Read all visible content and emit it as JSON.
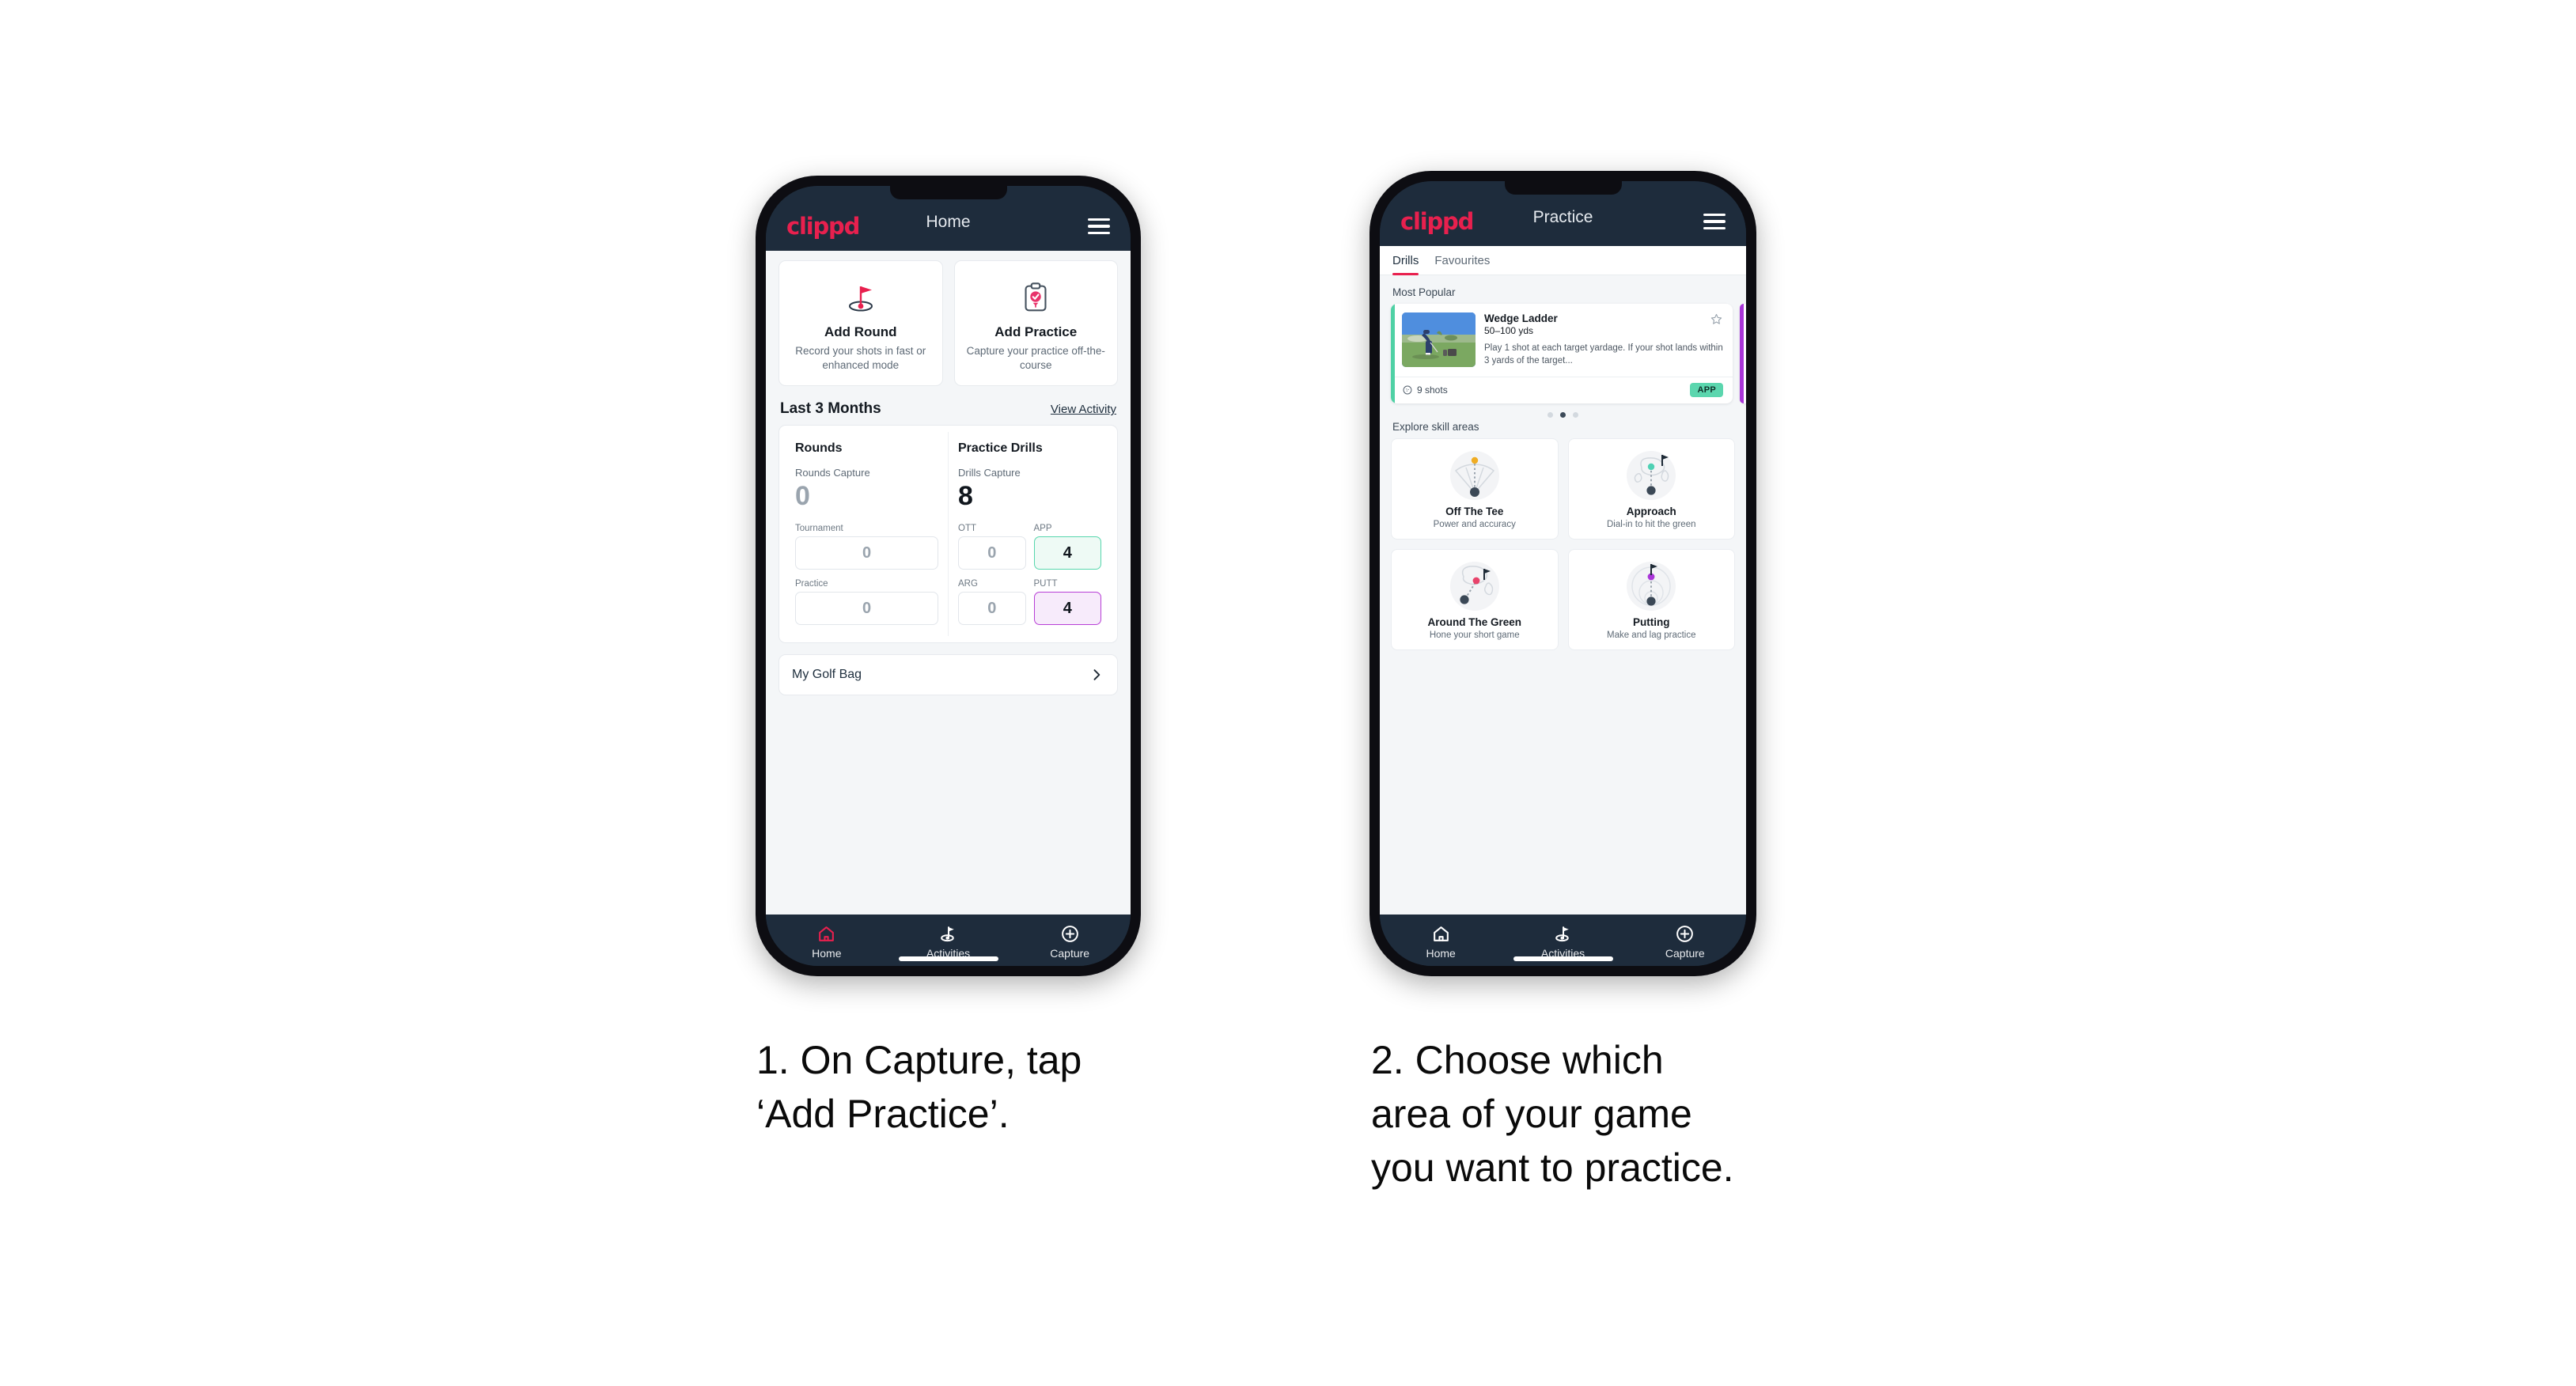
{
  "brand": {
    "logo": "clippd",
    "accent": "#e8204e",
    "dark_bg": "#1e2c3c"
  },
  "phone1": {
    "header": {
      "logo": "clippd",
      "title": "Home",
      "menu_icon": "hamburger-menu-icon"
    },
    "actions": [
      {
        "icon": "golf-flag-icon",
        "title": "Add Round",
        "subtitle": "Record your shots in fast or enhanced mode"
      },
      {
        "icon": "clipboard-check-icon",
        "title": "Add Practice",
        "subtitle": "Capture your practice off-the-course"
      }
    ],
    "section": {
      "title": "Last 3 Months",
      "link": "View Activity"
    },
    "rounds": {
      "heading": "Rounds",
      "capture_label": "Rounds Capture",
      "capture_value": "0",
      "metrics": [
        {
          "label": "Tournament",
          "value": "0",
          "highlight": "none"
        },
        {
          "label": "Practice",
          "value": "0",
          "highlight": "none"
        }
      ]
    },
    "drills": {
      "heading": "Practice Drills",
      "capture_label": "Drills Capture",
      "capture_value": "8",
      "metrics": [
        {
          "label": "OTT",
          "value": "0",
          "highlight": "none"
        },
        {
          "label": "APP",
          "value": "4",
          "highlight": "mint"
        },
        {
          "label": "ARG",
          "value": "0",
          "highlight": "none"
        },
        {
          "label": "PUTT",
          "value": "4",
          "highlight": "violet"
        }
      ]
    },
    "golf_bag": {
      "label": "My Golf Bag",
      "chevron_icon": "chevron-right-icon"
    },
    "nav": [
      {
        "label": "Home",
        "icon": "home-icon",
        "active": true
      },
      {
        "label": "Activities",
        "icon": "golf-flag-nav-icon",
        "active": false
      },
      {
        "label": "Capture",
        "icon": "plus-circle-icon",
        "active": false
      }
    ]
  },
  "phone2": {
    "header": {
      "logo": "clippd",
      "title": "Practice",
      "menu_icon": "hamburger-menu-icon"
    },
    "tabs": [
      {
        "label": "Drills",
        "active": true
      },
      {
        "label": "Favourites",
        "active": false
      }
    ],
    "most_popular_label": "Most Popular",
    "drill_card": {
      "title": "Wedge Ladder",
      "yardage": "50–100 yds",
      "description": "Play 1 shot at each target yardage. If your shot lands within 3 yards of the target...",
      "shots": "9 shots",
      "shots_icon": "golf-ball-icon",
      "badge": "APP",
      "badge_color": "#5bd6ae",
      "accent_color": "#4fd1a5",
      "star_icon": "star-outline-icon",
      "thumbnail": "golfer-chipping-photo"
    },
    "next_card_accent": "#a935d8",
    "carousel_dots": {
      "count": 3,
      "active_index": 1
    },
    "explore_label": "Explore skill areas",
    "skill_areas": [
      {
        "name": "Off The Tee",
        "subtitle": "Power and accuracy",
        "icon": "tee-fan-icon",
        "dot_color": "#f0ad24"
      },
      {
        "name": "Approach",
        "subtitle": "Dial-in to hit the green",
        "icon": "green-approach-icon",
        "dot_color": "#4fd1b4"
      },
      {
        "name": "Around The Green",
        "subtitle": "Hone your short game",
        "icon": "chip-green-icon",
        "dot_color": "#e8436b"
      },
      {
        "name": "Putting",
        "subtitle": "Make and lag practice",
        "icon": "putting-rings-icon",
        "dot_color": "#a935d8"
      }
    ],
    "nav": [
      {
        "label": "Home",
        "icon": "home-icon",
        "active": false
      },
      {
        "label": "Activities",
        "icon": "golf-flag-nav-icon",
        "active": false
      },
      {
        "label": "Capture",
        "icon": "plus-circle-icon",
        "active": false
      }
    ]
  },
  "captions": {
    "step1": "1. On Capture, tap\n‘Add Practice’.",
    "step2": "2. Choose which\narea of your game\nyou want to practice."
  }
}
